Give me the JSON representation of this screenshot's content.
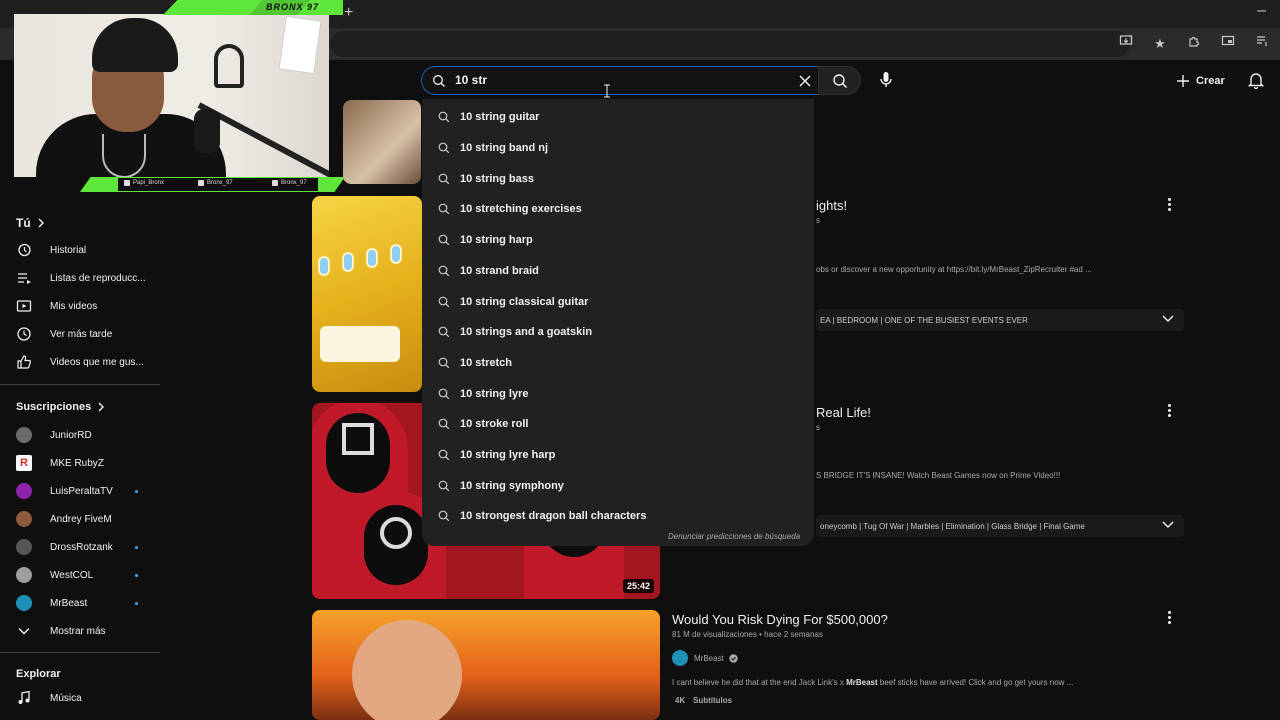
{
  "browser": {
    "new_tab_glyph": "+",
    "minimize_glyph": "–",
    "toolbar_icons": [
      "install-app-icon",
      "bookmark-star-icon",
      "extensions-icon",
      "cast-icon",
      "reading-list-icon"
    ]
  },
  "search": {
    "query": "10 str",
    "suggestions": [
      "10 string guitar",
      "10 string band nj",
      "10 string bass",
      "10 stretching exercises",
      "10 string harp",
      "10 strand braid",
      "10 string classical guitar",
      "10 strings and a goatskin",
      "10 stretch",
      "10 string lyre",
      "10 stroke roll",
      "10 string lyre harp",
      "10 string symphony",
      "10 strongest dragon ball characters"
    ],
    "report_label": "Denunciar predicciones de búsqueda"
  },
  "masthead": {
    "create_label": "Crear"
  },
  "overlay": {
    "brand": "BRONX 97",
    "socials": [
      {
        "icon": "twitter-icon",
        "label": "Papi_Bronx"
      },
      {
        "icon": "instagram-icon",
        "label": "Bronx_97"
      },
      {
        "icon": "youtube-icon",
        "label": "Bronx_97"
      }
    ]
  },
  "sidebar": {
    "you_heading": "Tú",
    "you_items": [
      {
        "label": "Historial",
        "icon": "history-icon"
      },
      {
        "label": "Listas de reproducc...",
        "icon": "playlist-icon"
      },
      {
        "label": "Mis videos",
        "icon": "my-videos-icon"
      },
      {
        "label": "Ver más tarde",
        "icon": "watch-later-icon"
      },
      {
        "label": "Videos que me gus...",
        "icon": "like-icon"
      }
    ],
    "subs_heading": "Suscripciones",
    "subscriptions": [
      {
        "label": "JuniorRD",
        "color": "#6b6b6b",
        "live": false
      },
      {
        "label": "MKE RubyZ",
        "color": "#d32f2f",
        "live": false
      },
      {
        "label": "LuisPeraltaTV",
        "color": "#8e24aa",
        "live": true
      },
      {
        "label": "Andrey FiveM",
        "color": "#8d5a3a",
        "live": false
      },
      {
        "label": "DrossRotzank",
        "color": "#555555",
        "live": true
      },
      {
        "label": "WestCOL",
        "color": "#9e9e9e",
        "live": true
      },
      {
        "label": "MrBeast",
        "color": "#1e8fb8",
        "live": true
      }
    ],
    "show_more": "Mostrar más",
    "explore_heading": "Explorar",
    "explore_items": [
      {
        "label": "Música",
        "icon": "music-icon"
      }
    ]
  },
  "videos": [
    {
      "title_visible": "ights!",
      "meta_visible": "s",
      "desc_visible": "obs or discover a new opportunity at https://bit.ly/MrBeast_ZipRecruiter #ad ...",
      "chapters_visible": "EA | BEDROOM | ONE OF THE BUSIEST EVENTS EVER"
    },
    {
      "title_visible": "Real Life!",
      "meta_visible": "s",
      "desc_visible": "S BRIDGE IT'S INSANE! Watch Beast Games now on Prime Video!!!",
      "chapters_visible": "oneycomb | Tug Of War | Marbles | Elimination | Glass Bridge | Final Game",
      "duration": "25:42"
    },
    {
      "title": "Would You Risk Dying For $500,000?",
      "meta": "81 M de visualizaciones • hace 2 semanas",
      "channel": "MrBeast",
      "desc_prefix": "I cant believe he did that at the end Jack Link's x ",
      "desc_bold": "MrBeast",
      "desc_suffix": " beef sticks have arrived! Click and go get yours now ...",
      "badge_4k": "4K",
      "badge_subs": "Subtítulos"
    }
  ]
}
